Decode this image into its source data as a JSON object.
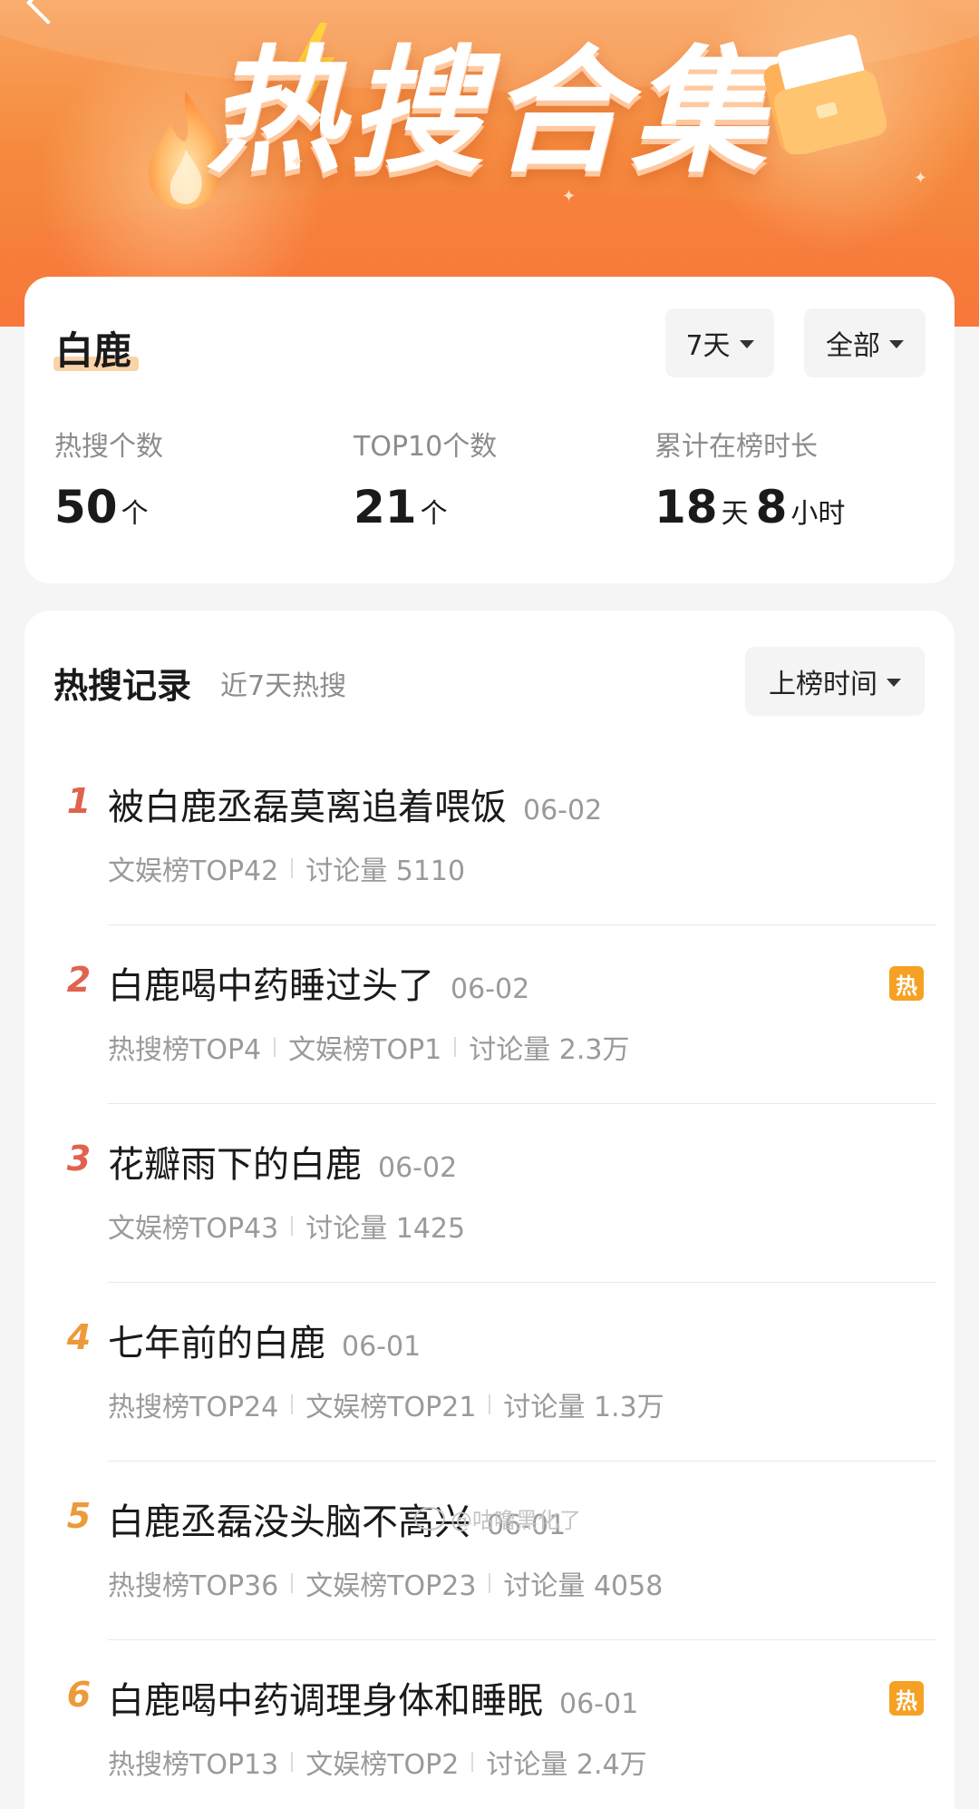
{
  "banner": {
    "title": "热搜合集"
  },
  "summary": {
    "name": "白鹿",
    "period_filter": "7天",
    "scope_filter": "全部",
    "stats": [
      {
        "label": "热搜个数",
        "value": "50",
        "unit": "个"
      },
      {
        "label": "TOP10个数",
        "value": "21",
        "unit": "个"
      },
      {
        "label": "累计在榜时长",
        "days": "18",
        "days_unit": "天",
        "hours": "8",
        "hours_unit": "小时"
      }
    ]
  },
  "records": {
    "title": "热搜记录",
    "subtitle": "近7天热搜",
    "sort_label": "上榜时间",
    "items": [
      {
        "rank": "1",
        "title": "被白鹿丞磊莫离追着喂饭",
        "date": "06-02",
        "meta": [
          "文娱榜TOP42",
          "讨论量 5110"
        ],
        "hot": false
      },
      {
        "rank": "2",
        "title": "白鹿喝中药睡过头了",
        "date": "06-02",
        "meta": [
          "热搜榜TOP4",
          "文娱榜TOP1",
          "讨论量 2.3万"
        ],
        "hot": true
      },
      {
        "rank": "3",
        "title": "花瓣雨下的白鹿",
        "date": "06-02",
        "meta": [
          "文娱榜TOP43",
          "讨论量 1425"
        ],
        "hot": false
      },
      {
        "rank": "4",
        "title": "七年前的白鹿",
        "date": "06-01",
        "meta": [
          "热搜榜TOP24",
          "文娱榜TOP21",
          "讨论量 1.3万"
        ],
        "hot": false
      },
      {
        "rank": "5",
        "title": "白鹿丞磊没头脑不高兴",
        "date": "06-01",
        "meta": [
          "热搜榜TOP36",
          "文娱榜TOP23",
          "讨论量 4058"
        ],
        "hot": false
      },
      {
        "rank": "6",
        "title": "白鹿喝中药调理身体和睡眠",
        "date": "06-01",
        "meta": [
          "热搜榜TOP13",
          "文娱榜TOP2",
          "讨论量 2.4万"
        ],
        "hot": true
      }
    ],
    "hot_badge_label": "热"
  },
  "watermark": "@咕噜黑化了",
  "colors": {
    "rank_top3": "#e0634f",
    "rank_other": "#ec9a3a",
    "hot_badge": "#f6a123",
    "banner_top": "#f9a45e",
    "banner_bottom": "#f4783a"
  }
}
